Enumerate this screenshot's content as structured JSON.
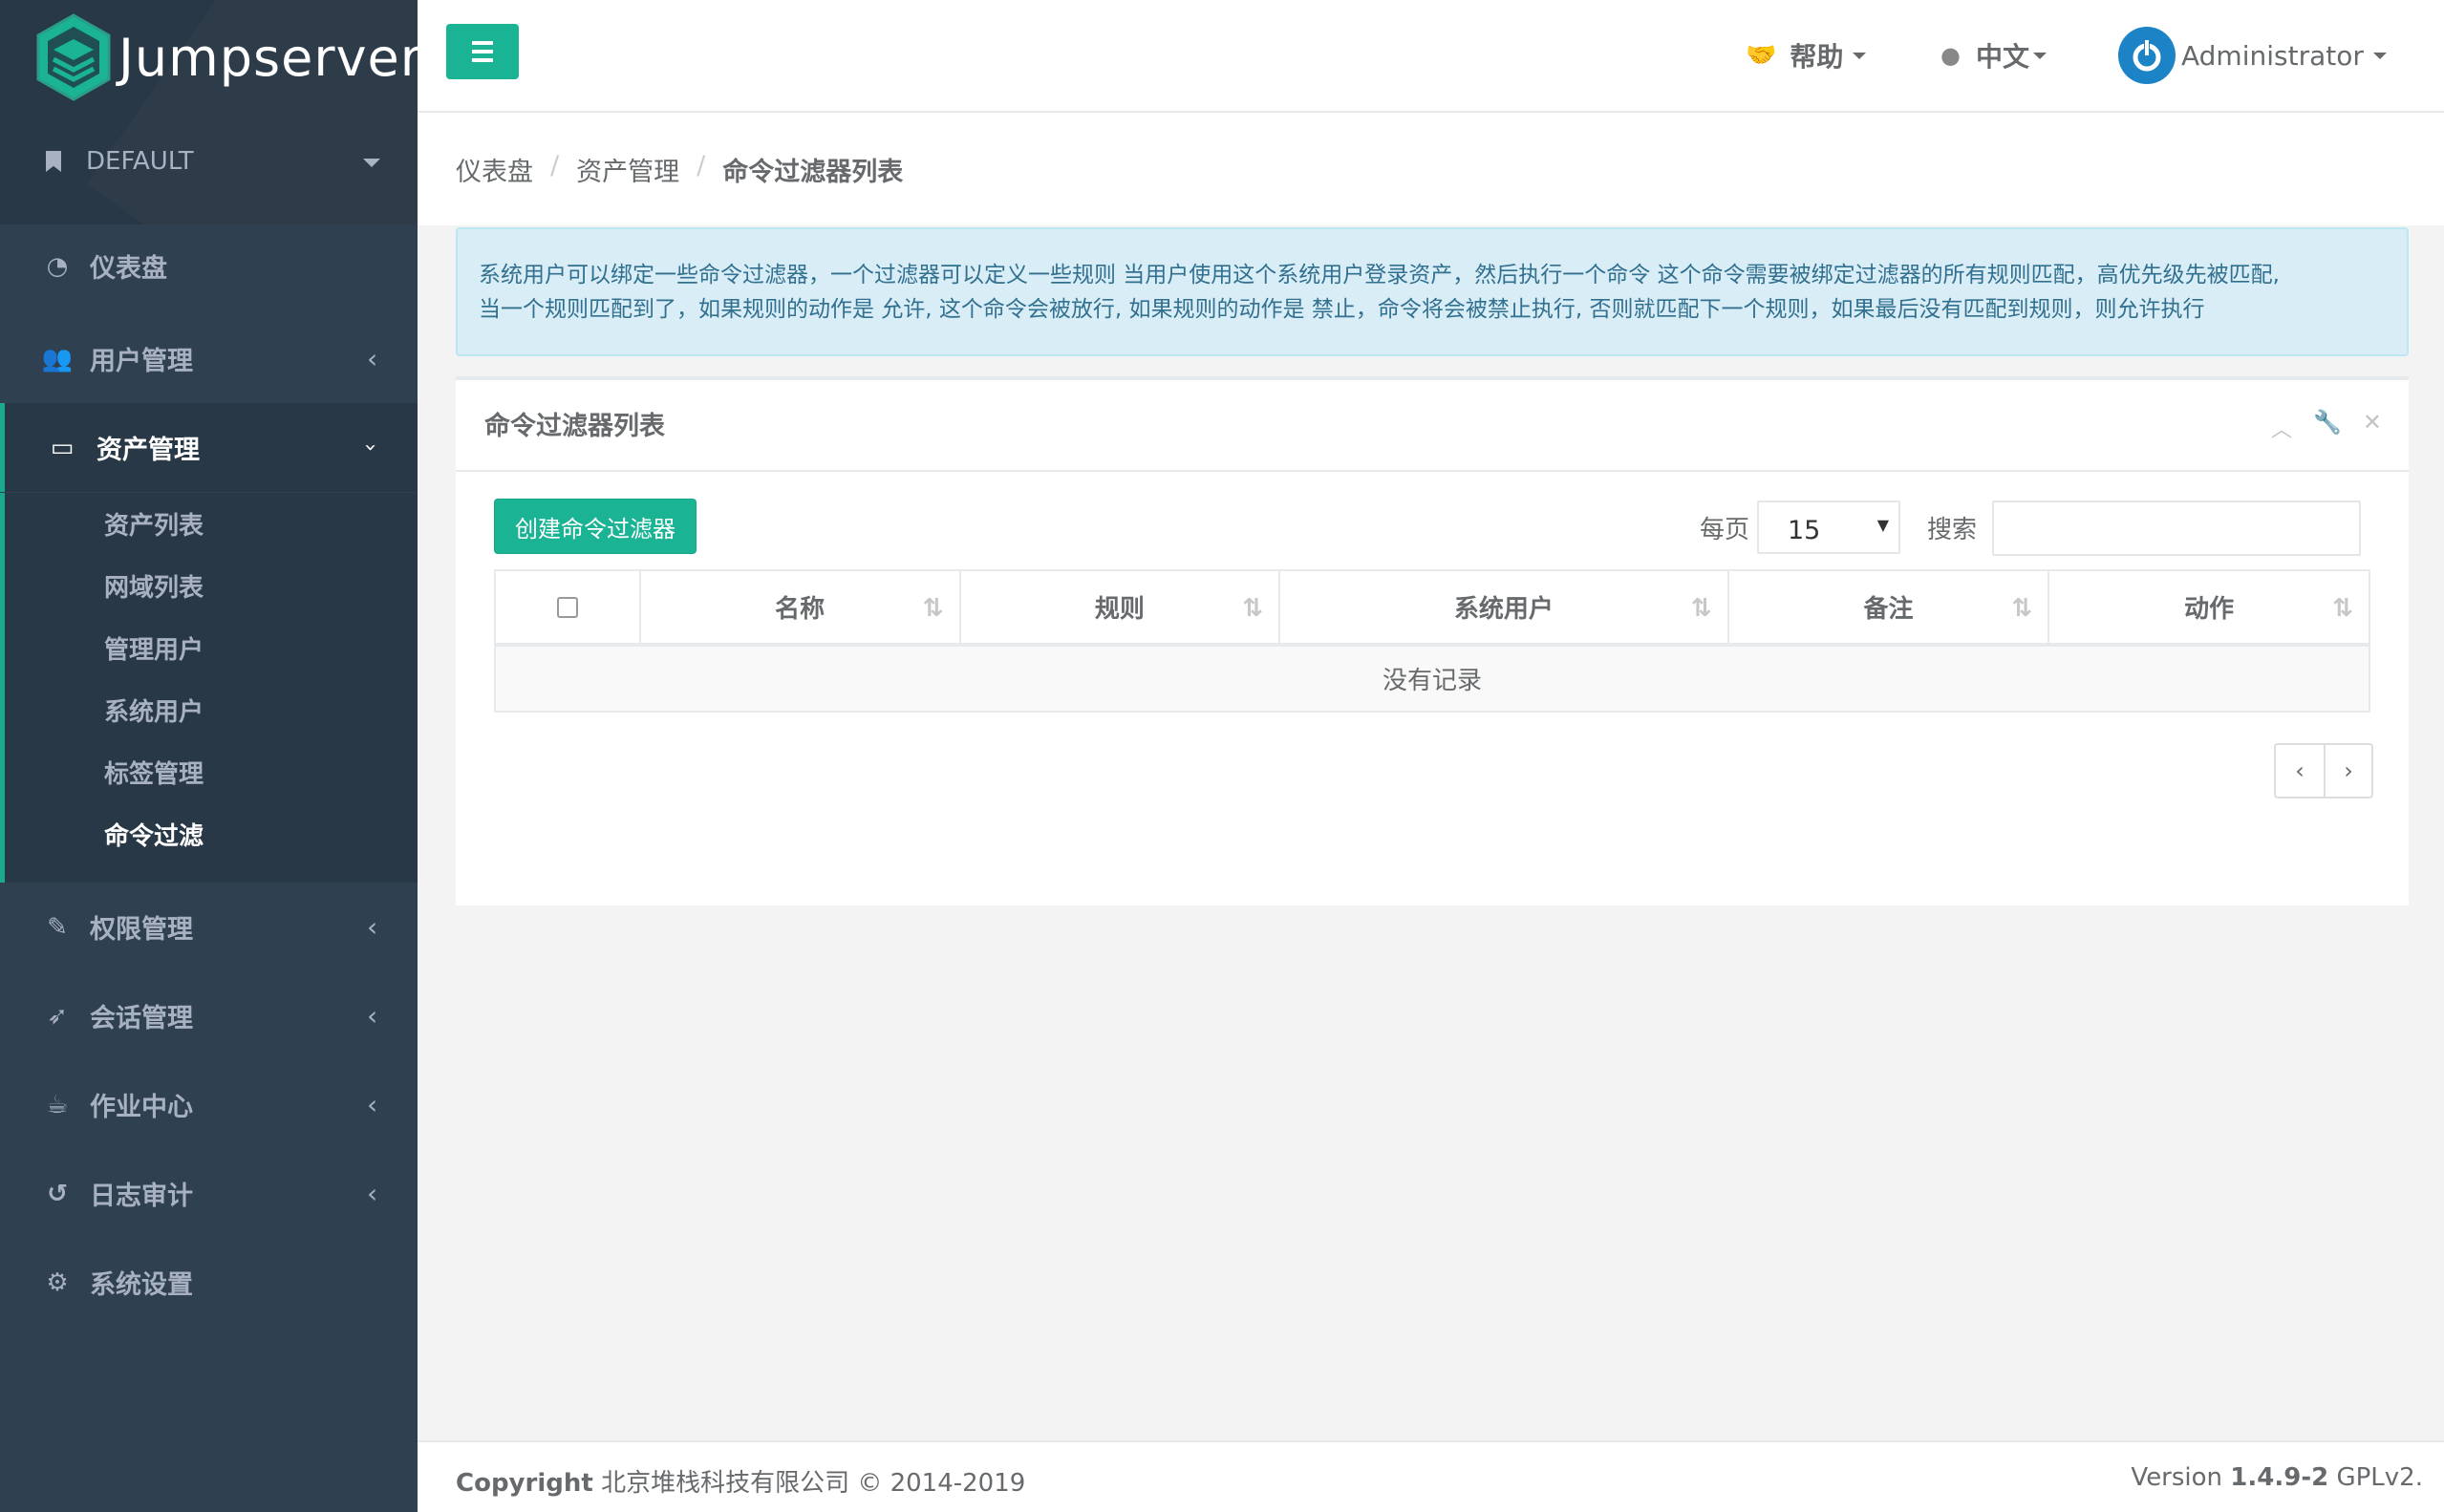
{
  "brand": {
    "name": "Jumpserver"
  },
  "org": {
    "label": "DEFAULT"
  },
  "sidebar": {
    "items": [
      {
        "label": "仪表盘",
        "icon": "dashboard-icon"
      },
      {
        "label": "用户管理",
        "icon": "users-icon"
      },
      {
        "label": "资产管理",
        "icon": "inbox-icon"
      },
      {
        "label": "权限管理",
        "icon": "edit-icon"
      },
      {
        "label": "会话管理",
        "icon": "rocket-icon"
      },
      {
        "label": "作业中心",
        "icon": "coffee-icon"
      },
      {
        "label": "日志审计",
        "icon": "history-icon"
      },
      {
        "label": "系统设置",
        "icon": "gears-icon"
      }
    ],
    "sub_items": [
      "资产列表",
      "网域列表",
      "管理用户",
      "系统用户",
      "标签管理",
      "命令过滤"
    ]
  },
  "topbar": {
    "help": "帮助",
    "lang": "中文",
    "user": "Administrator"
  },
  "breadcrumb": [
    "仪表盘",
    "资产管理",
    "命令过滤器列表"
  ],
  "alert": {
    "line1": "系统用户可以绑定一些命令过滤器，一个过滤器可以定义一些规则 当用户使用这个系统用户登录资产，然后执行一个命令 这个命令需要被绑定过滤器的所有规则匹配，高优先级先被匹配,",
    "line2": "当一个规则匹配到了，如果规则的动作是 允许, 这个命令会被放行, 如果规则的动作是 禁止，命令将会被禁止执行, 否则就匹配下一个规则，如果最后没有匹配到规则，则允许执行"
  },
  "panel": {
    "title": "命令过滤器列表",
    "create_label": "创建命令过滤器",
    "per_page_label": "每页",
    "per_page_value": "15",
    "search_label": "搜索",
    "columns": [
      "名称",
      "规则",
      "系统用户",
      "备注",
      "动作"
    ],
    "empty_text": "没有记录",
    "prev": "‹",
    "next": "›"
  },
  "footer": {
    "copyright_label": "Copyright",
    "copyright_text": "北京堆栈科技有限公司 © 2014-2019",
    "version_label": "Version",
    "version_number": "1.4.9-2",
    "license": "GPLv2."
  },
  "colors": {
    "accent": "#1ab394",
    "sidebar": "#2f4050",
    "info_bg": "#d9edf7",
    "user_icon": "#1c84c6"
  }
}
